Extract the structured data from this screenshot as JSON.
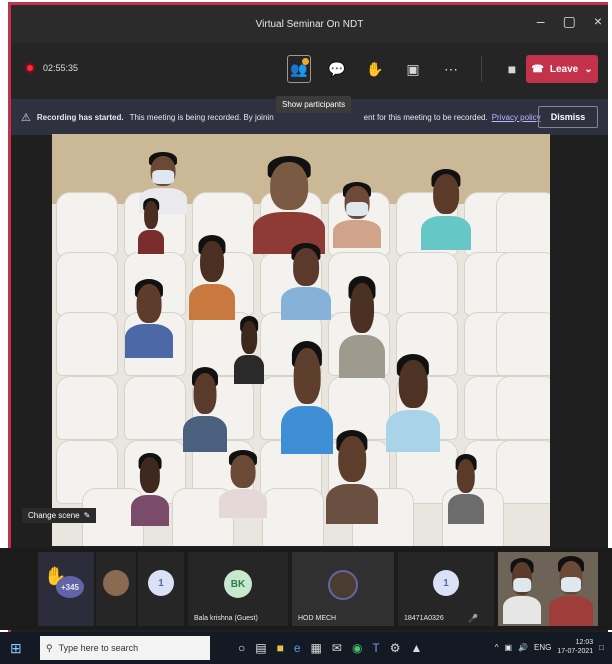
{
  "window": {
    "title": "Virtual Seminar On NDT"
  },
  "toolbar": {
    "timer": "02:55:35",
    "participants_tooltip": "Show participants",
    "leave_label": "Leave"
  },
  "notice": {
    "bold_text": "Recording has started.",
    "text": "This meeting is being recorded. By joinin",
    "text_end": "ent for this meeting to be recorded.",
    "link": "Privacy policy",
    "dismiss_label": "Dismiss"
  },
  "stage": {
    "change_scene_label": "Change scene"
  },
  "strip": {
    "raised_hands_count": "+345",
    "tiles": [
      {
        "initials": "",
        "label": ""
      },
      {
        "initials": "1",
        "label": ""
      },
      {
        "initials": "BK",
        "label": "Bala krishna (Guest)"
      },
      {
        "initials": "",
        "label": "HOD MECH"
      },
      {
        "initials": "1",
        "label": "18471A0326"
      }
    ]
  },
  "taskbar": {
    "search_placeholder": "Type here to search",
    "lang": "ENG",
    "time": "12:03",
    "date": "17-07-2021"
  },
  "colors": {
    "leave": "#c4314b",
    "accent": "#6264a7"
  }
}
